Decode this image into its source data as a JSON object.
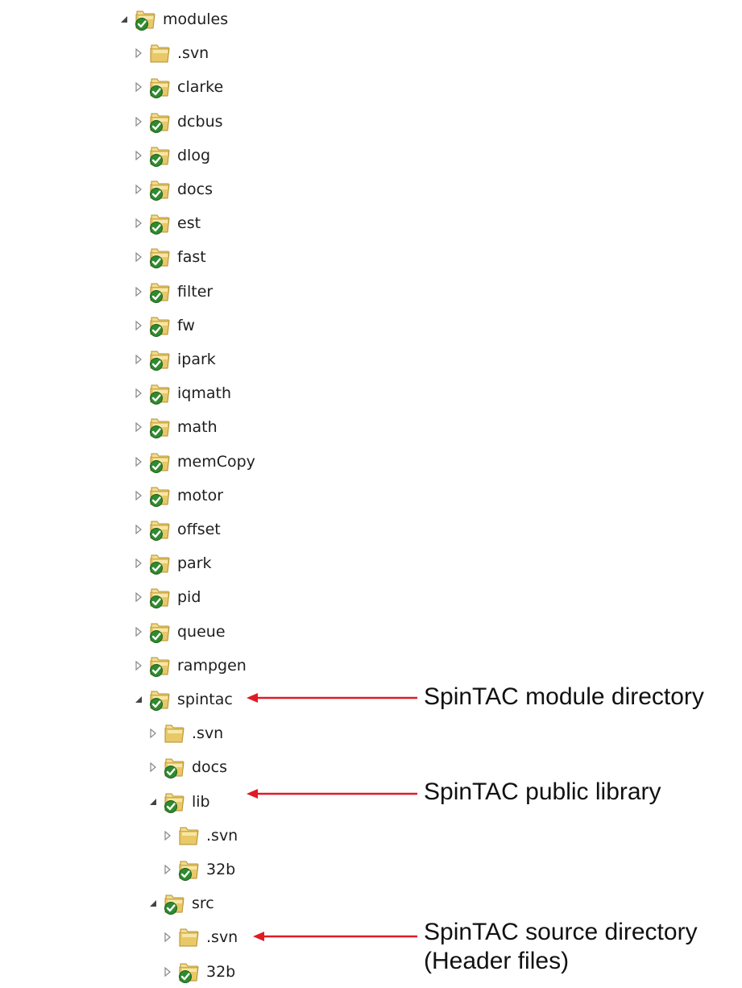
{
  "tree": [
    {
      "label": "modules",
      "depth": 0,
      "state": "expanded",
      "icon": "svn-ok-folder-icon"
    },
    {
      "label": ".svn",
      "depth": 1,
      "state": "collapsed",
      "icon": "plain-folder-icon"
    },
    {
      "label": "clarke",
      "depth": 1,
      "state": "collapsed",
      "icon": "svn-ok-folder-icon"
    },
    {
      "label": "dcbus",
      "depth": 1,
      "state": "collapsed",
      "icon": "svn-ok-folder-icon"
    },
    {
      "label": "dlog",
      "depth": 1,
      "state": "collapsed",
      "icon": "svn-ok-folder-icon"
    },
    {
      "label": "docs",
      "depth": 1,
      "state": "collapsed",
      "icon": "svn-ok-folder-icon"
    },
    {
      "label": "est",
      "depth": 1,
      "state": "collapsed",
      "icon": "svn-ok-folder-icon"
    },
    {
      "label": "fast",
      "depth": 1,
      "state": "collapsed",
      "icon": "svn-ok-folder-icon"
    },
    {
      "label": "filter",
      "depth": 1,
      "state": "collapsed",
      "icon": "svn-ok-folder-icon"
    },
    {
      "label": "fw",
      "depth": 1,
      "state": "collapsed",
      "icon": "svn-ok-folder-icon"
    },
    {
      "label": "ipark",
      "depth": 1,
      "state": "collapsed",
      "icon": "svn-ok-folder-icon"
    },
    {
      "label": "iqmath",
      "depth": 1,
      "state": "collapsed",
      "icon": "svn-ok-folder-icon"
    },
    {
      "label": "math",
      "depth": 1,
      "state": "collapsed",
      "icon": "svn-ok-folder-icon"
    },
    {
      "label": "memCopy",
      "depth": 1,
      "state": "collapsed",
      "icon": "svn-ok-folder-icon"
    },
    {
      "label": "motor",
      "depth": 1,
      "state": "collapsed",
      "icon": "svn-ok-folder-icon"
    },
    {
      "label": "offset",
      "depth": 1,
      "state": "collapsed",
      "icon": "svn-ok-folder-icon"
    },
    {
      "label": "park",
      "depth": 1,
      "state": "collapsed",
      "icon": "svn-ok-folder-icon"
    },
    {
      "label": "pid",
      "depth": 1,
      "state": "collapsed",
      "icon": "svn-ok-folder-icon"
    },
    {
      "label": "queue",
      "depth": 1,
      "state": "collapsed",
      "icon": "svn-ok-folder-icon"
    },
    {
      "label": "rampgen",
      "depth": 1,
      "state": "collapsed",
      "icon": "svn-ok-folder-icon"
    },
    {
      "label": "spintac",
      "depth": 1,
      "state": "expanded",
      "icon": "svn-ok-folder-icon"
    },
    {
      "label": ".svn",
      "depth": 2,
      "state": "collapsed",
      "icon": "plain-folder-icon"
    },
    {
      "label": "docs",
      "depth": 2,
      "state": "collapsed",
      "icon": "svn-ok-folder-icon"
    },
    {
      "label": "lib",
      "depth": 2,
      "state": "expanded",
      "icon": "svn-ok-folder-icon"
    },
    {
      "label": ".svn",
      "depth": 3,
      "state": "collapsed",
      "icon": "plain-folder-icon"
    },
    {
      "label": "32b",
      "depth": 3,
      "state": "collapsed",
      "icon": "svn-ok-folder-icon"
    },
    {
      "label": "src",
      "depth": 2,
      "state": "expanded",
      "icon": "svn-ok-folder-icon"
    },
    {
      "label": ".svn",
      "depth": 3,
      "state": "collapsed",
      "icon": "plain-folder-icon"
    },
    {
      "label": "32b",
      "depth": 3,
      "state": "collapsed",
      "icon": "svn-ok-folder-icon"
    }
  ],
  "annotations": [
    {
      "target": "spintac",
      "lines": [
        "SpinTAC module directory"
      ]
    },
    {
      "target": "lib",
      "lines": [
        "SpinTAC public library"
      ]
    },
    {
      "target": "32b",
      "lines": [
        "SpinTAC source directory",
        "(Header files)"
      ]
    }
  ],
  "colors": {
    "arrow": "#e01b24",
    "folder": "#e8c867",
    "svn_ok": "#2e8b2e"
  }
}
